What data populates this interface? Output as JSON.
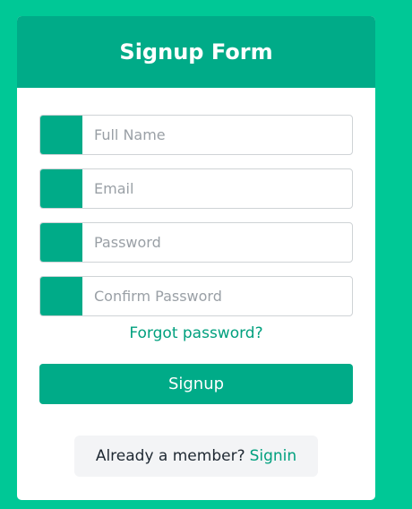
{
  "form": {
    "title": "Signup Form",
    "fields": [
      {
        "placeholder": "Full Name",
        "value": ""
      },
      {
        "placeholder": "Email",
        "value": ""
      },
      {
        "placeholder": "Password",
        "value": ""
      },
      {
        "placeholder": "Confirm Password",
        "value": ""
      }
    ],
    "forgot_label": "Forgot password?",
    "submit_label": "Signup",
    "member_text": "Already a member?",
    "signin_label": "Signin"
  },
  "colors": {
    "background": "#00c896",
    "accent": "#00ab88",
    "link": "#00a07e"
  }
}
